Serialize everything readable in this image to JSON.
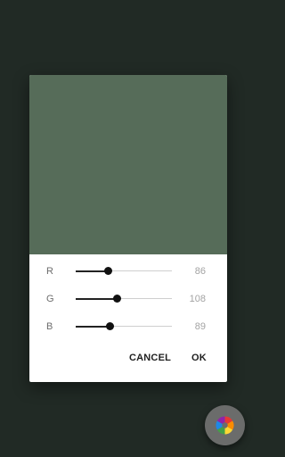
{
  "screen": {
    "background_color": "#212a25"
  },
  "dialog": {
    "preview_color": "#566c59",
    "channels": [
      {
        "label": "R",
        "value": "86",
        "fraction": 0.337
      },
      {
        "label": "G",
        "value": "108",
        "fraction": 0.424
      },
      {
        "label": "B",
        "value": "89",
        "fraction": 0.349
      }
    ],
    "cancel_label": "CANCEL",
    "ok_label": "OK"
  },
  "fab": {
    "icon": "color-wheel-icon"
  }
}
